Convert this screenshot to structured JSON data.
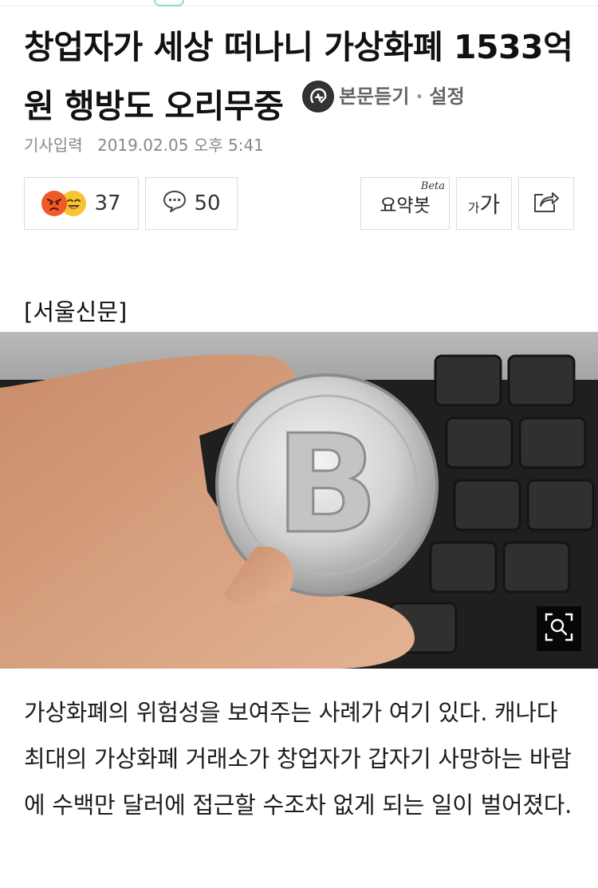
{
  "article": {
    "title": "창업자가 세상 떠나니 가상화폐 1533억원 행방도 오리무중",
    "listen_label": "본문듣기",
    "separator": "·",
    "settings_label": "설정",
    "date_label": "기사입력",
    "date_value": "2019.02.05 오후 5:41",
    "reaction_count": "37",
    "comment_count": "50",
    "summary_label": "요약봇",
    "summary_badge": "Beta",
    "font_small": "가",
    "font_big": "가",
    "source": "[서울신문]",
    "body": "가상화폐의 위험성을 보여주는 사례가 여기 있다. 캐나다 최대의 가상화폐 거래소가 창업자가 갑자기 사망하는 바람에 수백만 달러에 접근할 수조차 없게 되는 일이 벌어졌다."
  },
  "colors": {
    "angry": "#ef5a28",
    "happy": "#f7c531",
    "border": "#dcdcdc",
    "meta": "#888888"
  },
  "icons": [
    "listen-icon",
    "angry-face-icon",
    "happy-face-icon",
    "comment-icon",
    "share-icon",
    "zoom-icon"
  ]
}
